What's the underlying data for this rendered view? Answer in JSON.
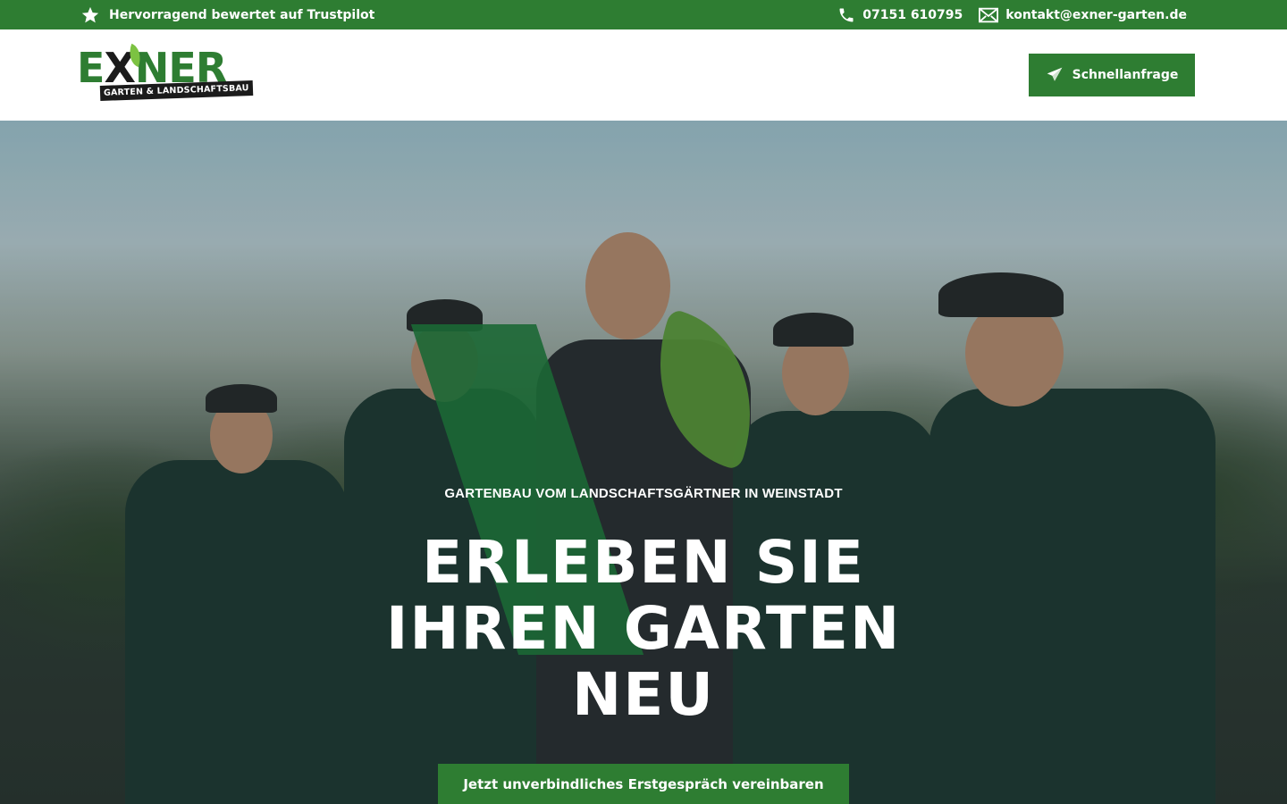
{
  "topbar": {
    "trustpilot_text": "Hervorragend bewertet auf Trustpilot",
    "phone": "07151 610795",
    "email": "kontakt@exner-garten.de",
    "icons": [
      "star-icon",
      "phone-icon",
      "mail-icon"
    ]
  },
  "header": {
    "logo": {
      "word_start": "E",
      "word_x": "X",
      "word_end": "NER",
      "tagline": "GARTEN & LANDSCHAFTSBAU"
    },
    "quick_request_label": "Schnellanfrage",
    "quick_request_icon": "paper-plane-icon"
  },
  "hero": {
    "kicker": "GARTENBAU VOM LANDSCHAFTSGÄRTNER IN WEINSTADT",
    "title_lines": [
      "ERLEBEN SIE",
      "IHREN GARTEN",
      "NEU"
    ],
    "cta_label": "Jetzt unverbindliches Erstgespräch vereinbaren"
  },
  "colors": {
    "brand_green": "#2e7d32",
    "highlight_green": "#1f7a3c",
    "leaf_green": "#7cc242",
    "dark": "#1b1b1b"
  }
}
